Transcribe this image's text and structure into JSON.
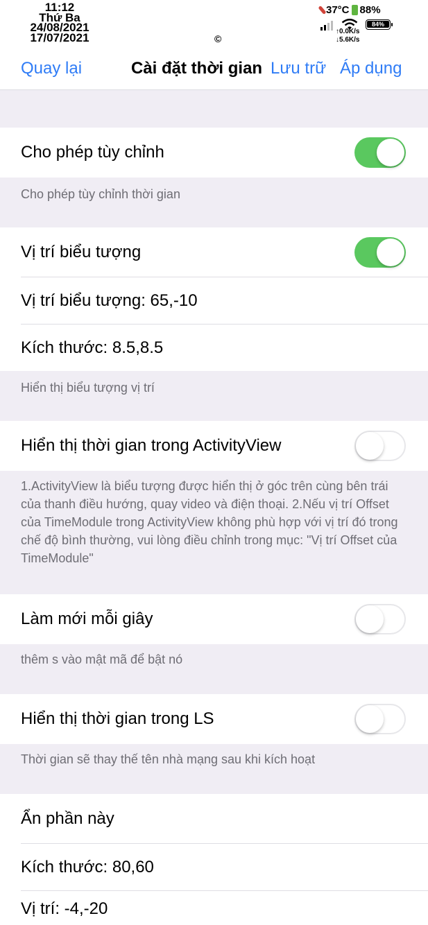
{
  "status_bar": {
    "time": "11:12",
    "weekday": "Thứ Ba",
    "date1": "24/08/2021",
    "date2": "17/07/2021",
    "center_icon": "©",
    "temperature": "37°C",
    "battery_percent": "88%",
    "battery_badge": "84%",
    "upload": "↑0.0K/s",
    "download": "↓5.6K/s"
  },
  "nav": {
    "back": "Quay lại",
    "title": "Cài đặt thời gian",
    "save": "Lưu trữ",
    "apply": "Áp dụng"
  },
  "settings": {
    "allow_custom": {
      "label": "Cho phép tùy chỉnh",
      "on": true
    },
    "allow_custom_footer": "Cho phép tùy chỉnh thời gian",
    "icon_position_toggle": {
      "label": "Vị trí biểu tượng",
      "on": true
    },
    "icon_position_value": "Vị trí biểu tượng:  65,-10",
    "icon_size": "Kích thước:  8.5,8.5",
    "icon_footer": "Hiển thị biểu tượng vị trí",
    "activity_view": {
      "label": "Hiển thị thời gian trong ActivityView",
      "on": false
    },
    "activity_footer": "1.ActivityView là biểu tượng được hiển thị ở góc trên cùng bên trái của thanh điều hướng, quay video và điện thoại. 2.Nếu vị trí Offset của TimeModule trong ActivityView không phù hợp với vị trí đó trong chế độ bình thường, vui lòng điều chỉnh trong mục: \"Vị trí Offset của TimeModule\"",
    "refresh_every_second": {
      "label": "Làm mới mỗi giây",
      "on": false
    },
    "refresh_footer": "thêm s vào mật mã để bật nó",
    "show_in_ls": {
      "label": "Hiển thị thời gian trong LS",
      "on": false
    },
    "ls_footer": "Thời gian sẽ thay thế tên nhà mạng sau khi kích hoạt",
    "hide_section": "Ẩn phần này",
    "section_size": "Kích thước:  80,60",
    "section_position": "Vị trí:  -4,-20"
  },
  "colors": {
    "accent": "#2f7cf6",
    "toggle_on": "#5ac85f",
    "background": "#f0edf4"
  }
}
